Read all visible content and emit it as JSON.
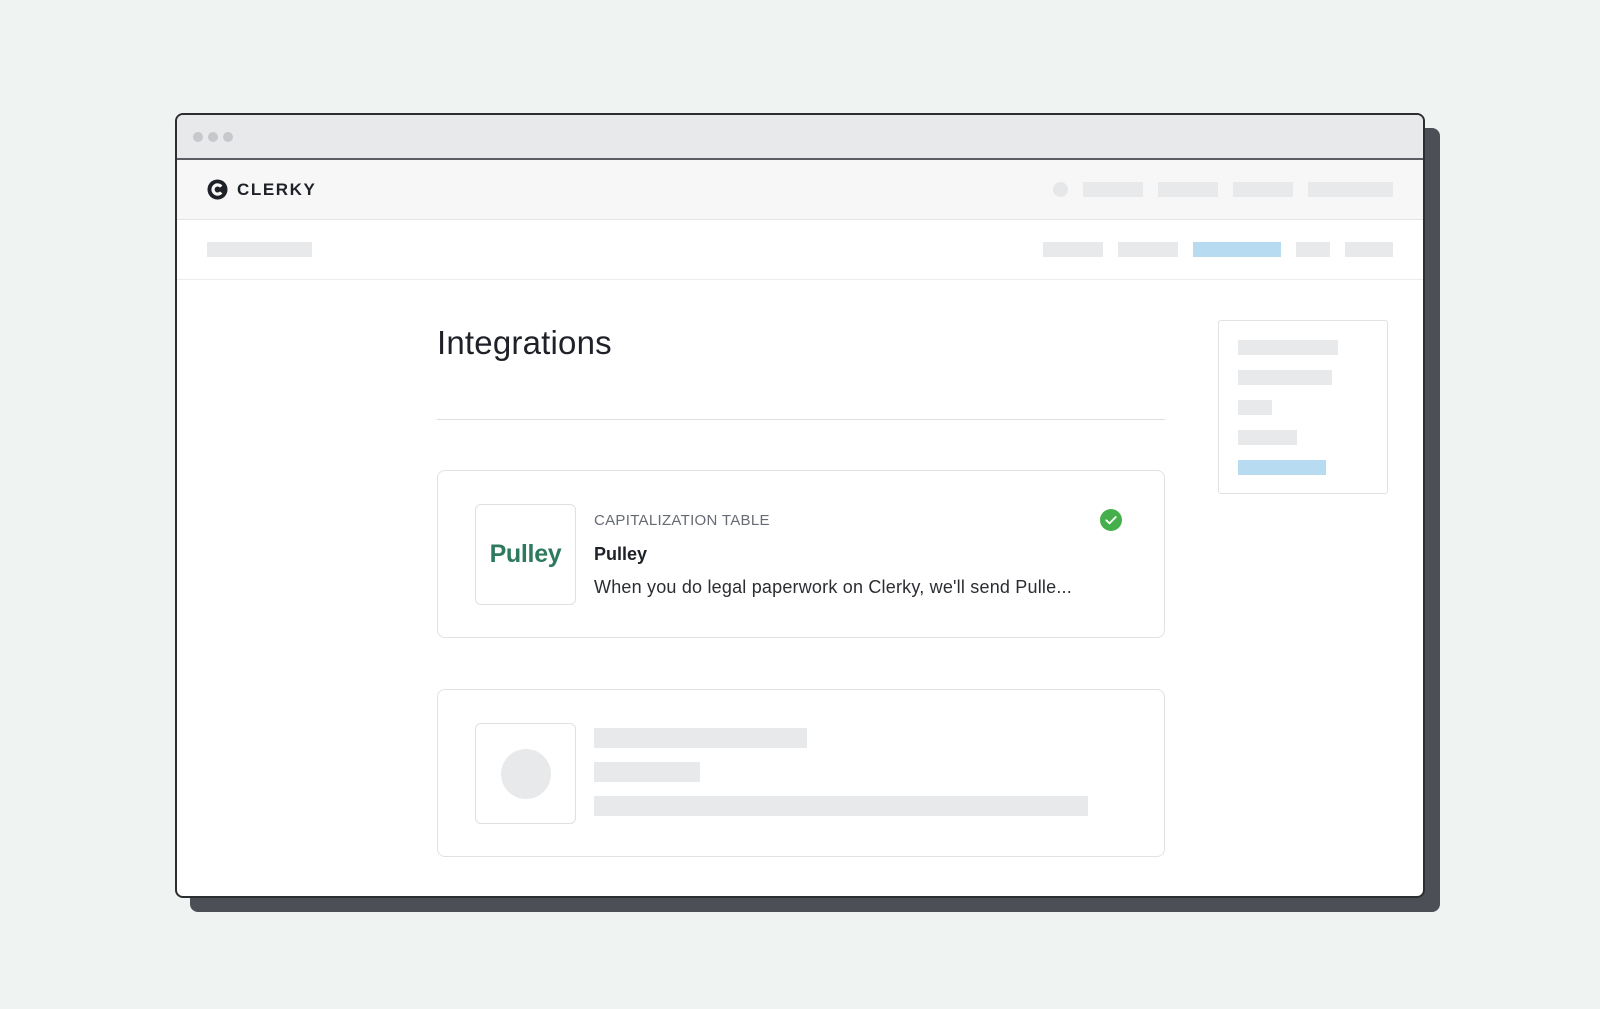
{
  "app": {
    "brand": "CLERKY"
  },
  "main": {
    "title": "Integrations"
  },
  "integrations": [
    {
      "category": "CAPITALIZATION TABLE",
      "name": "Pulley",
      "logo_text": "Pulley",
      "description": "When you do legal paperwork on Clerky, we'll send Pulle...",
      "status": "connected",
      "status_icon": "check-circle-icon"
    },
    {
      "placeholder": true
    }
  ],
  "colors": {
    "background": "#eff4f2",
    "brand_dark": "#1f2128",
    "pulley_green": "#2e7a5e",
    "success_green": "#45b04b",
    "active_link": "#b7dcf1"
  }
}
